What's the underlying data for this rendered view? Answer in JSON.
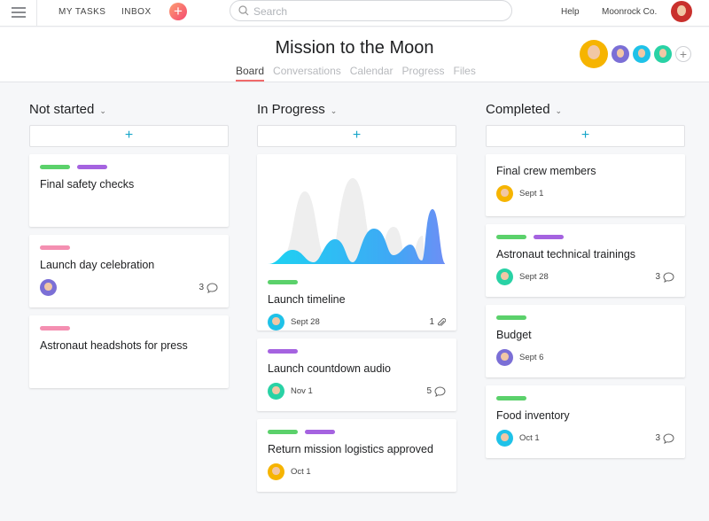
{
  "topbar": {
    "my_tasks": "MY TASKS",
    "inbox": "INBOX",
    "search_placeholder": "Search",
    "help": "Help",
    "org": "Moonrock Co."
  },
  "project": {
    "title": "Mission to the Moon",
    "tabs": [
      "Board",
      "Conversations",
      "Calendar",
      "Progress",
      "Files"
    ],
    "active_tab": "Board"
  },
  "colors": {
    "green": "#5bd16b",
    "purple": "#a563e0",
    "pink": "#f48fb1",
    "accent": "#f06a6a",
    "add": "#16a5c9"
  },
  "columns": [
    {
      "name": "Not started",
      "cards": [
        {
          "title": "Final safety checks",
          "tags": [
            "green",
            "purple"
          ],
          "height": 82
        },
        {
          "title": "Launch day celebration",
          "tags": [
            "pink"
          ],
          "avatar": "#7b6fd6",
          "comments": "3",
          "height": 82
        },
        {
          "title": "Astronaut headshots for press",
          "tags": [
            "pink"
          ],
          "height": 82
        }
      ]
    },
    {
      "name": "In Progress",
      "cards": [
        {
          "title": "Launch timeline",
          "tags": [
            "green"
          ],
          "chart": true,
          "avatar": "#1fc2e8",
          "date": "Sept 28",
          "attachments": "1"
        },
        {
          "title": "Launch countdown audio",
          "tags": [
            "purple"
          ],
          "avatar": "#29d2a5",
          "date": "Nov 1",
          "comments": "5"
        },
        {
          "title": "Return mission logistics approved",
          "tags": [
            "green",
            "purple"
          ],
          "avatar": "#f6b400",
          "date": "Oct 1"
        }
      ]
    },
    {
      "name": "Completed",
      "cards": [
        {
          "title": "Final crew members",
          "tags": [],
          "avatar": "#f6b400",
          "date": "Sept 1"
        },
        {
          "title": "Astronaut technical trainings",
          "tags": [
            "green",
            "purple"
          ],
          "avatar": "#29d2a5",
          "date": "Sept 28",
          "comments": "3"
        },
        {
          "title": "Budget",
          "tags": [
            "green"
          ],
          "avatar": "#7b6fd6",
          "date": "Sept 6"
        },
        {
          "title": "Food inventory",
          "tags": [
            "green"
          ],
          "avatar": "#1fc2e8",
          "date": "Oct 1",
          "comments": "3"
        }
      ]
    }
  ]
}
